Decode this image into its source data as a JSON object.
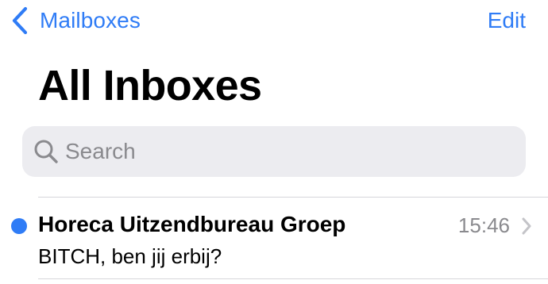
{
  "nav": {
    "back_label": "Mailboxes",
    "back_icon": "chevron-left-icon",
    "edit_label": "Edit",
    "accent_color": "#2f7cf6"
  },
  "page": {
    "title": "All Inboxes"
  },
  "search": {
    "placeholder": "Search",
    "icon": "magnifying-glass-icon"
  },
  "messages": [
    {
      "sender": "Horeca Uitzendbureau Groep",
      "subject": "BITCH, ben jij erbij?",
      "time": "15:46",
      "unread": true,
      "unread_color": "#2f7cf6"
    }
  ]
}
